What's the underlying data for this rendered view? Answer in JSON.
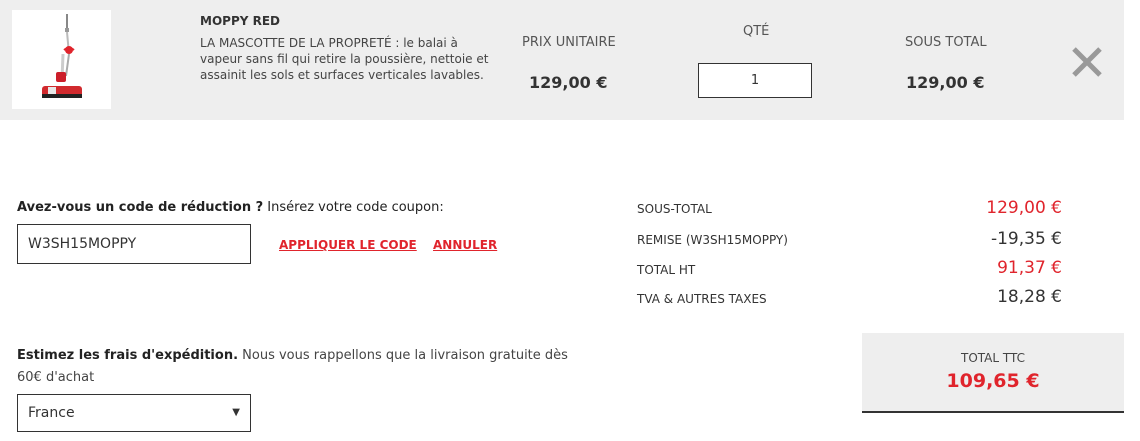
{
  "product": {
    "name": "MOPPY RED",
    "description": "LA MASCOTTE DE LA PROPRETÉ : le balai à vapeur sans fil qui retire la poussière, nettoie et assainit les sols et surfaces verticales lavables.",
    "image_icon": "steam-mop-product-image",
    "unit_price_label": "PRIX UNITAIRE",
    "unit_price": "129,00 €",
    "qty_label": "QTÉ",
    "qty": "1",
    "subtotal_label": "SOUS TOTAL",
    "subtotal": "129,00 €",
    "remove_icon": "close-icon"
  },
  "coupon": {
    "title_bold": "Avez-vous un code de réduction ?",
    "title_rest": " Insérez votre code coupon:",
    "code": "W3SH15MOPPY",
    "apply_label": "APPLIQUER LE CODE",
    "cancel_label": "ANNULER"
  },
  "totals": {
    "rows": [
      {
        "label": "SOUS-TOTAL",
        "value": "129,00 €",
        "color": "#e0242c"
      },
      {
        "label": "REMISE (W3SH15MOPPY)",
        "value": "-19,35 €",
        "color": "#333333"
      },
      {
        "label": "TOTAL HT",
        "value": "91,37 €",
        "color": "#e0242c"
      },
      {
        "label": "TVA & AUTRES TAXES",
        "value": "18,28 €",
        "color": "#333333"
      }
    ],
    "ttc_label": "TOTAL TTC",
    "ttc_value": "109,65 €"
  },
  "shipping": {
    "title_bold": "Estimez les frais d'expédition.",
    "title_rest": " Nous vous rappellons que la livraison gratuite dès 60€ d'achat",
    "country": "France",
    "dropdown_icon": "caret-down-icon"
  },
  "colors": {
    "accent": "#e0242c",
    "panel": "#eeeeee",
    "text": "#333333"
  }
}
